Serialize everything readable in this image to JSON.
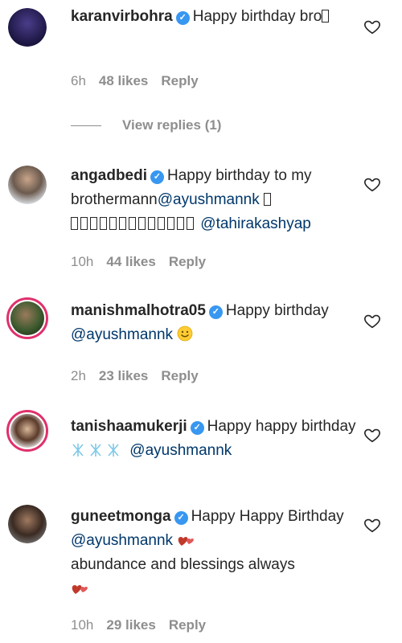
{
  "comments": [
    {
      "username": "karanvirbohra",
      "verified": true,
      "text": "Happy birthday bro",
      "time": "6h",
      "likes": "48 likes",
      "reply": "Reply",
      "view_replies": "View replies (1)"
    },
    {
      "username": "angadbedi",
      "verified": true,
      "text_part1": "Happy birthday to my brothermann",
      "mention1": "@ayushmannk",
      "mention2": "@tahirakashyap",
      "time": "10h",
      "likes": "44 likes",
      "reply": "Reply"
    },
    {
      "username": "manishmalhotra05",
      "verified": true,
      "text_part1": "Happy birthday",
      "mention1": "@ayushmannk",
      "time": "2h",
      "likes": "23 likes",
      "reply": "Reply"
    },
    {
      "username": "tanishaamukerji",
      "verified": true,
      "text_part1": "Happy happy birthday",
      "mention1": "@ayushmannk",
      "time": "",
      "likes": "",
      "reply": ""
    },
    {
      "username": "guneetmonga",
      "verified": true,
      "text_part1": "Happy Happy Birthday",
      "mention1": "@ayushmannk",
      "text_part2": "abundance and blessings always",
      "time": "10h",
      "likes": "29 likes",
      "reply": "Reply"
    }
  ],
  "icons": {
    "verified": "verified-badge-icon",
    "like": "heart-outline-icon"
  },
  "colors": {
    "verified": "#3897f0",
    "mention": "#00376b",
    "meta": "#8e8e8e",
    "story_ring": "#e1306c"
  }
}
